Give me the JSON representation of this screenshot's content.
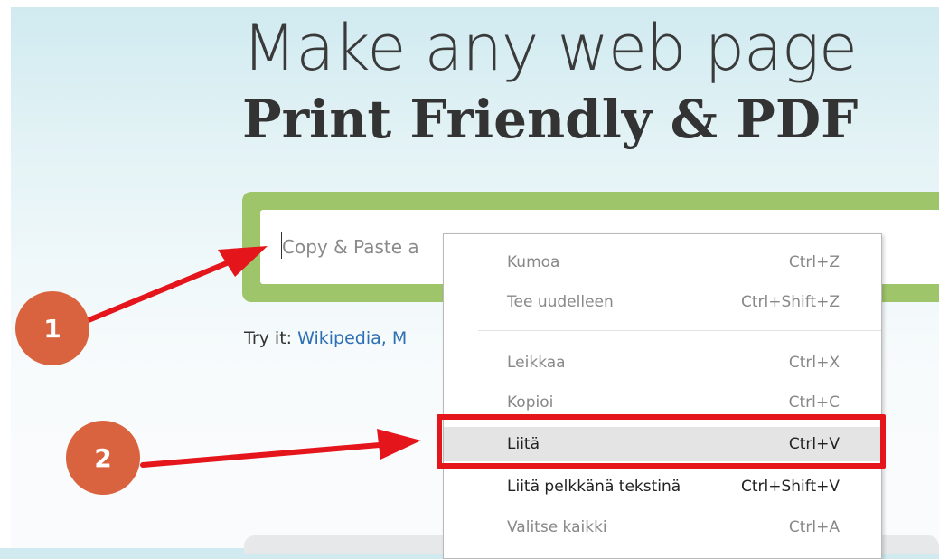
{
  "hero": {
    "title_line1": "Make any web page",
    "title_line2": "Print Friendly & PDF"
  },
  "url_input": {
    "placeholder": "Copy & Paste a"
  },
  "try_it": {
    "label": "Try it:",
    "links": [
      "Wikipedia, M"
    ]
  },
  "context_menu": {
    "items": [
      {
        "label": "Kumoa",
        "shortcut": "Ctrl+Z",
        "enabled": false
      },
      {
        "label": "Tee uudelleen",
        "shortcut": "Ctrl+Shift+Z",
        "enabled": false
      },
      {
        "label": "Leikkaa",
        "shortcut": "Ctrl+X",
        "enabled": false
      },
      {
        "label": "Kopioi",
        "shortcut": "Ctrl+C",
        "enabled": false
      },
      {
        "label": "Liitä",
        "shortcut": "Ctrl+V",
        "enabled": true,
        "highlighted": true
      },
      {
        "label": "Liitä pelkkänä tekstinä",
        "shortcut": "Ctrl+Shift+V",
        "enabled": true
      },
      {
        "label": "Valitse kaikki",
        "shortcut": "Ctrl+A",
        "enabled": false
      }
    ]
  },
  "annotations": {
    "step1": "1",
    "step2": "2",
    "arrow_color": "#e4151b",
    "badge_color": "#d9633e",
    "box_color": "#e4151b"
  },
  "colors": {
    "input_frame": "#9fc56b",
    "link": "#2f6fb3"
  }
}
